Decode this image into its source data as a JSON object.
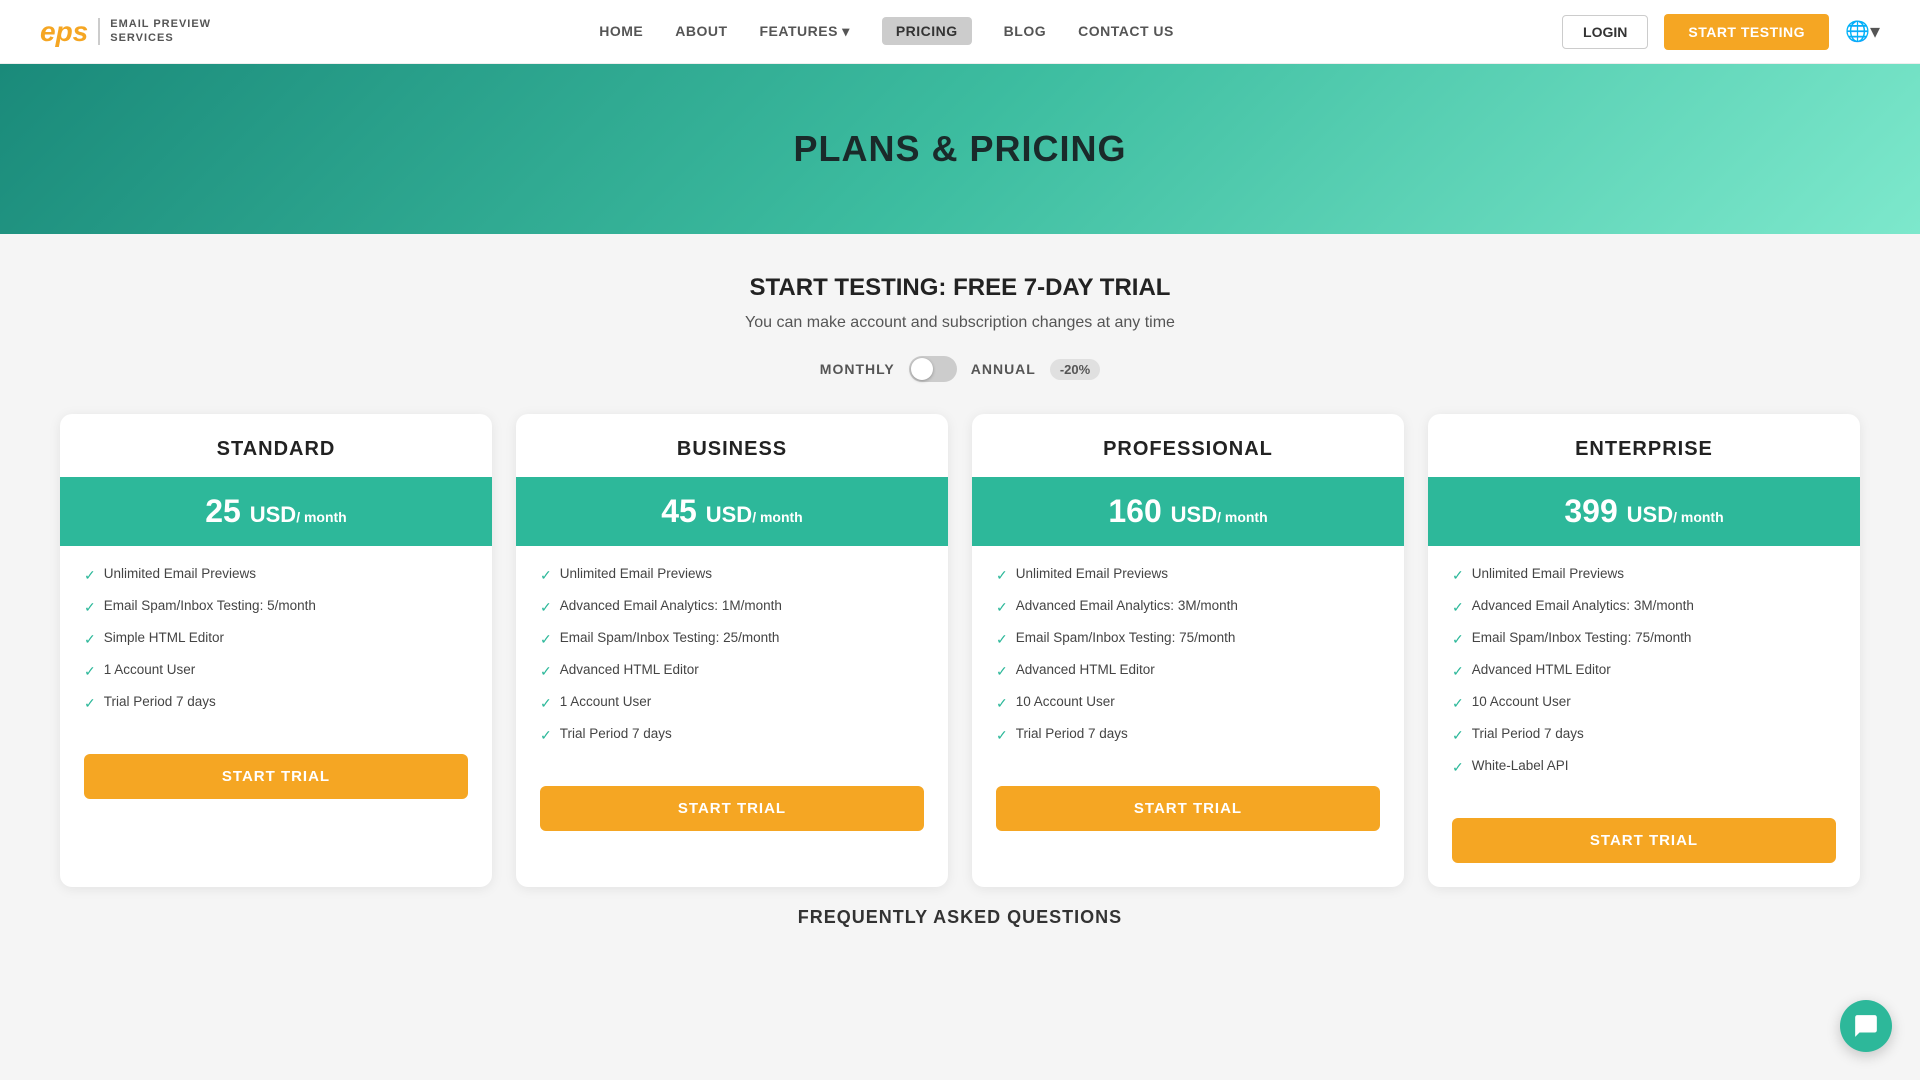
{
  "nav": {
    "logo_text": "EMAIL PREVIEW\nSERVICES",
    "logo_abbr": "eps",
    "links": [
      {
        "id": "home",
        "label": "HOME",
        "active": false
      },
      {
        "id": "about",
        "label": "ABOUT",
        "active": false
      },
      {
        "id": "features",
        "label": "FEATURES",
        "active": false,
        "dropdown": true
      },
      {
        "id": "pricing",
        "label": "PRICING",
        "active": true
      },
      {
        "id": "blog",
        "label": "BLOG",
        "active": false
      },
      {
        "id": "contact",
        "label": "CONTACT US",
        "active": false
      }
    ],
    "login_label": "LOGIN",
    "start_testing_label": "START TESTING"
  },
  "hero": {
    "title": "PLANS & PRICING"
  },
  "pricing": {
    "headline": "START TESTING: FREE 7-DAY TRIAL",
    "subtext": "You can make account and subscription changes at any time",
    "billing_monthly": "MONTHLY",
    "billing_annual": "ANNUAL",
    "discount_badge": "-20%",
    "plans": [
      {
        "id": "standard",
        "title": "STANDARD",
        "price": "25 USD",
        "unit": "/ month",
        "features": [
          "Unlimited Email Previews",
          "Email Spam/Inbox Testing: 5/month",
          "Simple HTML Editor",
          "1 Account User",
          "Trial Period 7 days"
        ],
        "cta": "START TRIAL"
      },
      {
        "id": "business",
        "title": "BUSINESS",
        "price": "45 USD",
        "unit": "/ month",
        "features": [
          "Unlimited Email Previews",
          "Advanced Email Analytics: 1M/month",
          "Email Spam/Inbox Testing: 25/month",
          "Advanced HTML Editor",
          "1 Account User",
          "Trial Period 7 days"
        ],
        "cta": "START TRIAL"
      },
      {
        "id": "professional",
        "title": "PROFESSIONAL",
        "price": "160 USD",
        "unit": "/ month",
        "features": [
          "Unlimited Email Previews",
          "Advanced Email Analytics: 3M/month",
          "Email Spam/Inbox Testing: 75/month",
          "Advanced HTML Editor",
          "10 Account User",
          "Trial Period 7 days"
        ],
        "cta": "START TRIAL"
      },
      {
        "id": "enterprise",
        "title": "ENTERPRISE",
        "price": "399 USD",
        "unit": "/ month",
        "features": [
          "Unlimited Email Previews",
          "Advanced Email Analytics: 3M/month",
          "Email Spam/Inbox Testing: 75/month",
          "Advanced HTML Editor",
          "10 Account User",
          "Trial Period 7 days",
          "White-Label API"
        ],
        "cta": "START TRIAL"
      }
    ]
  },
  "footer_hint": "FREQUENTLY ASKED QUESTIONS"
}
